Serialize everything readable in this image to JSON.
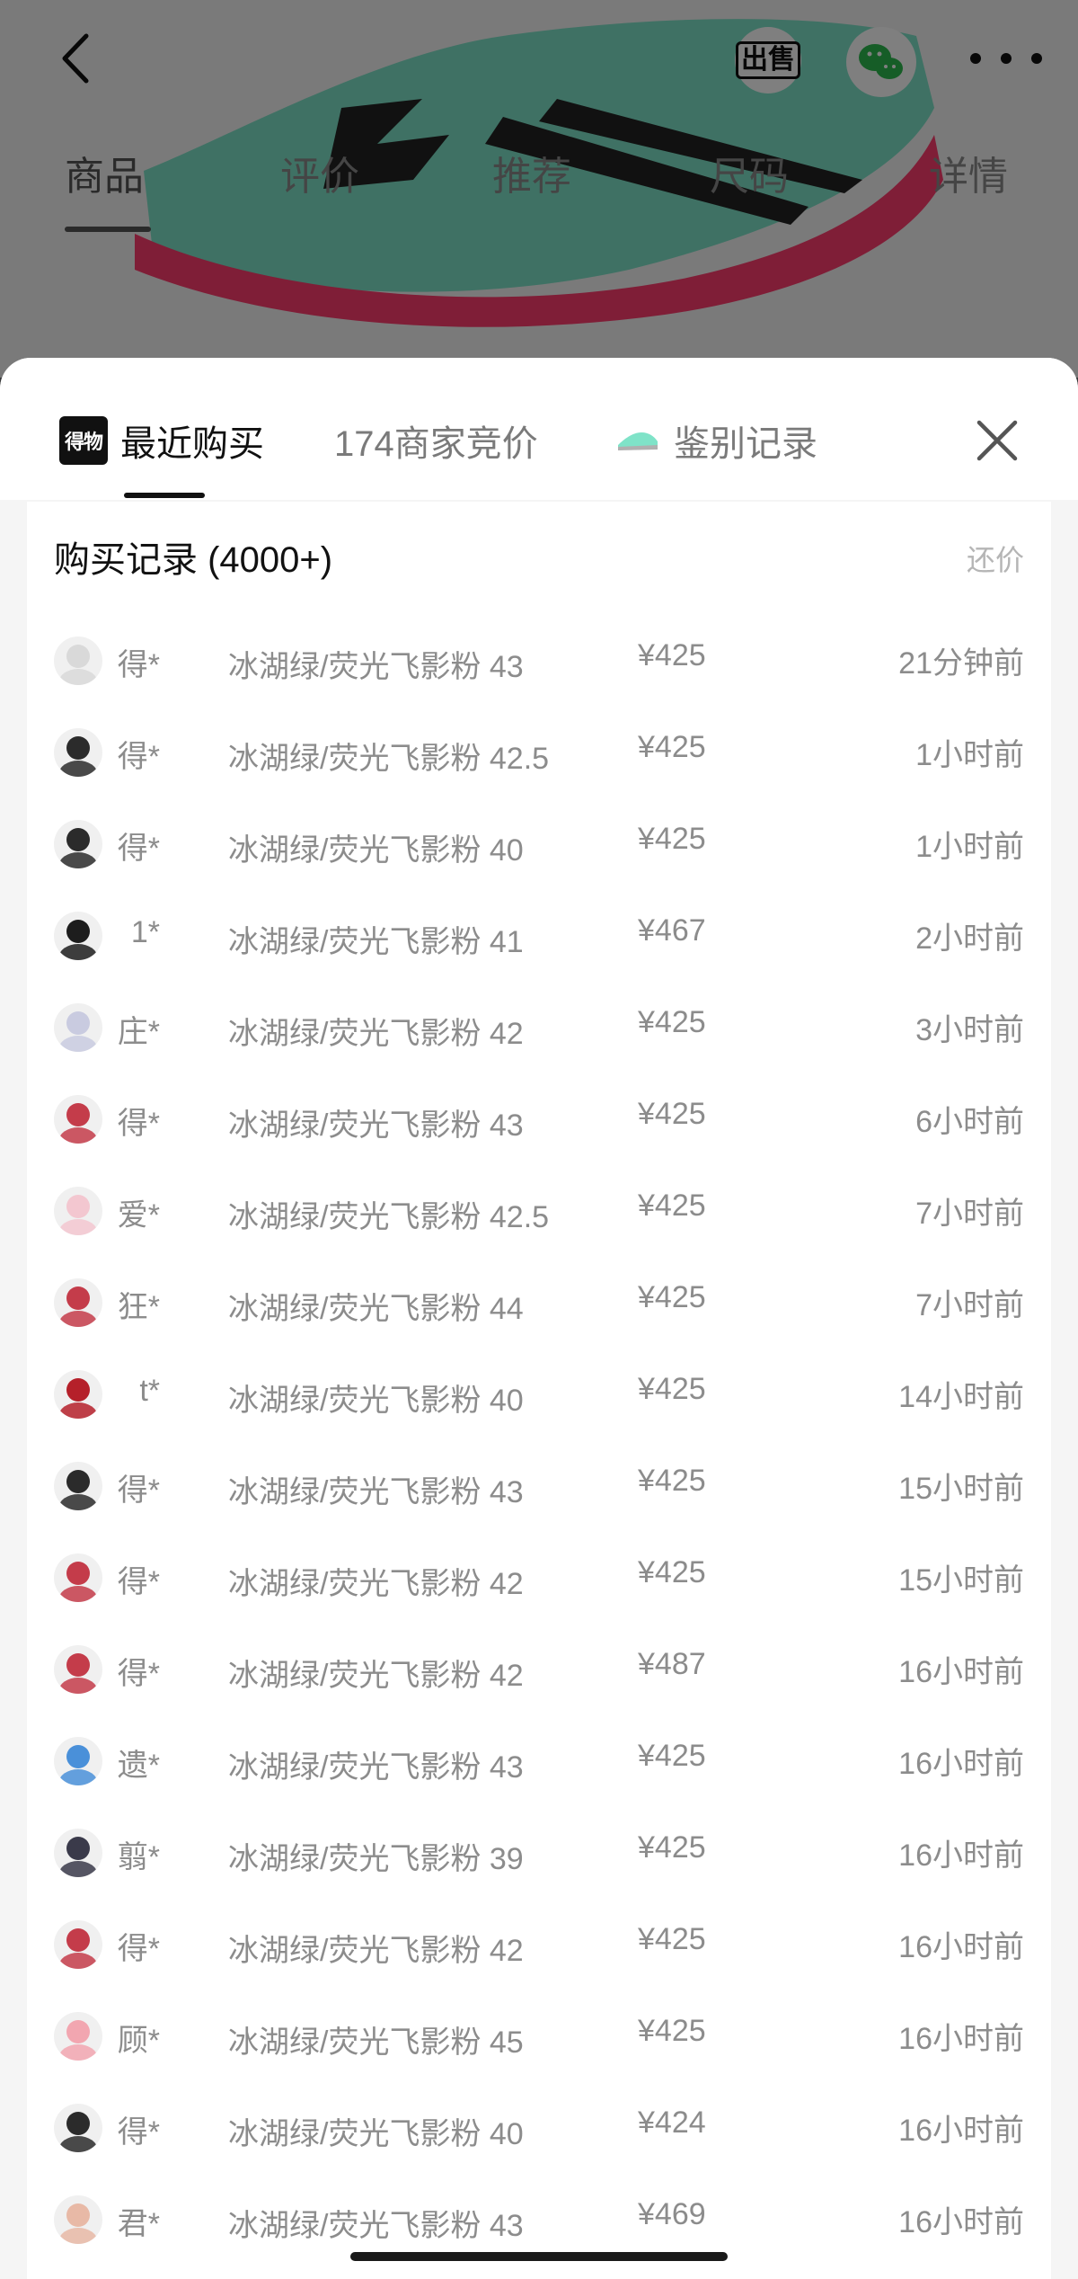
{
  "product_page": {
    "tabs": [
      "商品",
      "评价",
      "推荐",
      "尺码",
      "详情"
    ],
    "active_tab": 0,
    "sell_label": "出售"
  },
  "sheet": {
    "tabs": [
      {
        "label": "最近购买",
        "icon": "du-logo-icon",
        "logo_text": "得物"
      },
      {
        "label": "174商家竞价"
      },
      {
        "label": "鉴别记录",
        "icon": "sneaker-icon"
      }
    ],
    "active_tab": 0,
    "card_title": "购买记录 (4000+)",
    "counter_offer_label": "还价",
    "records": [
      {
        "user": "得*",
        "spec": "冰湖绿/荧光飞影粉 43",
        "price": "¥425",
        "time": "21分钟前",
        "avatar_color": "#d9d9d9"
      },
      {
        "user": "得*",
        "spec": "冰湖绿/荧光飞影粉 42.5",
        "price": "¥425",
        "time": "1小时前",
        "avatar_color": "#2b2b2b"
      },
      {
        "user": "得*",
        "spec": "冰湖绿/荧光飞影粉 40",
        "price": "¥425",
        "time": "1小时前",
        "avatar_color": "#2b2b2b"
      },
      {
        "user": "1*",
        "spec": "冰湖绿/荧光飞影粉 41",
        "price": "¥467",
        "time": "2小时前",
        "avatar_color": "#1d1d1d"
      },
      {
        "user": "庄*",
        "spec": "冰湖绿/荧光飞影粉 42",
        "price": "¥425",
        "time": "3小时前",
        "avatar_color": "#c9cbe0"
      },
      {
        "user": "得*",
        "spec": "冰湖绿/荧光飞影粉 43",
        "price": "¥425",
        "time": "6小时前",
        "avatar_color": "#c43c4a"
      },
      {
        "user": "爱*",
        "spec": "冰湖绿/荧光飞影粉 42.5",
        "price": "¥425",
        "time": "7小时前",
        "avatar_color": "#f3c7d0"
      },
      {
        "user": "狂*",
        "spec": "冰湖绿/荧光飞影粉 44",
        "price": "¥425",
        "time": "7小时前",
        "avatar_color": "#c43c4a"
      },
      {
        "user": "t*",
        "spec": "冰湖绿/荧光飞影粉 40",
        "price": "¥425",
        "time": "14小时前",
        "avatar_color": "#b5202a"
      },
      {
        "user": "得*",
        "spec": "冰湖绿/荧光飞影粉 43",
        "price": "¥425",
        "time": "15小时前",
        "avatar_color": "#2b2b2b"
      },
      {
        "user": "得*",
        "spec": "冰湖绿/荧光飞影粉 42",
        "price": "¥425",
        "time": "15小时前",
        "avatar_color": "#c43c4a"
      },
      {
        "user": "得*",
        "spec": "冰湖绿/荧光飞影粉 42",
        "price": "¥487",
        "time": "16小时前",
        "avatar_color": "#c43c4a"
      },
      {
        "user": "遗*",
        "spec": "冰湖绿/荧光飞影粉 43",
        "price": "¥425",
        "time": "16小时前",
        "avatar_color": "#4a90d9"
      },
      {
        "user": "翦*",
        "spec": "冰湖绿/荧光飞影粉 39",
        "price": "¥425",
        "time": "16小时前",
        "avatar_color": "#3a3a4a"
      },
      {
        "user": "得*",
        "spec": "冰湖绿/荧光飞影粉 42",
        "price": "¥425",
        "time": "16小时前",
        "avatar_color": "#c43c4a"
      },
      {
        "user": "顾*",
        "spec": "冰湖绿/荧光飞影粉 45",
        "price": "¥425",
        "time": "16小时前",
        "avatar_color": "#f2a6b0"
      },
      {
        "user": "得*",
        "spec": "冰湖绿/荧光飞影粉 40",
        "price": "¥424",
        "time": "16小时前",
        "avatar_color": "#2b2b2b"
      },
      {
        "user": "君*",
        "spec": "冰湖绿/荧光飞影粉 43",
        "price": "¥469",
        "time": "16小时前",
        "avatar_color": "#e8b9a6"
      }
    ]
  }
}
